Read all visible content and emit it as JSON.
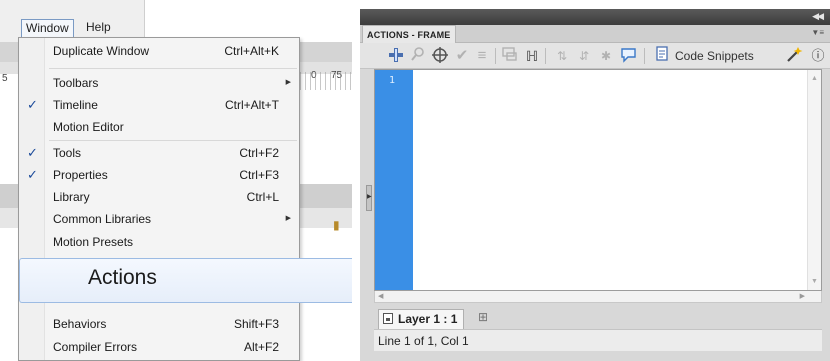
{
  "menubar": {
    "items": [
      "Window",
      "Help"
    ]
  },
  "background": {
    "left_numeral": "5",
    "mid_numeral": "0",
    "right_numeral": "75"
  },
  "window_menu": {
    "items": [
      {
        "label": "Duplicate Window",
        "shortcut": "Ctrl+Alt+K",
        "checked": false,
        "submenu": false
      },
      {
        "label": "Toolbars",
        "shortcut": "",
        "checked": false,
        "submenu": true
      },
      {
        "label": "Timeline",
        "shortcut": "Ctrl+Alt+T",
        "checked": true,
        "submenu": false
      },
      {
        "label": "Motion Editor",
        "shortcut": "",
        "checked": false,
        "submenu": false
      },
      {
        "label": "Tools",
        "shortcut": "Ctrl+F2",
        "checked": true,
        "submenu": false
      },
      {
        "label": "Properties",
        "shortcut": "Ctrl+F3",
        "checked": true,
        "submenu": false
      },
      {
        "label": "Library",
        "shortcut": "Ctrl+L",
        "checked": false,
        "submenu": false
      },
      {
        "label": "Common Libraries",
        "shortcut": "",
        "checked": false,
        "submenu": true
      },
      {
        "label": "Motion Presets",
        "shortcut": "",
        "checked": false,
        "submenu": false
      },
      {
        "label": "Actions",
        "shortcut": "",
        "checked": false,
        "submenu": false,
        "highlighted": true
      },
      {
        "label": "Behaviors",
        "shortcut": "Shift+F3",
        "checked": false,
        "submenu": false
      },
      {
        "label": "Compiler Errors",
        "shortcut": "Alt+F2",
        "checked": false,
        "submenu": false
      }
    ]
  },
  "actions_panel": {
    "tab_title": "ACTIONS - FRAME",
    "toolbar": {
      "code_snippets_label": "Code Snippets",
      "icons": [
        "add-script-icon",
        "find-icon",
        "insert-target-path-icon",
        "check-syntax-icon",
        "auto-format-icon",
        "show-code-hint-icon",
        "debug-options-icon",
        "collapse-between-braces-icon",
        "collapse-selection-icon",
        "expand-all-icon",
        "comment-icon",
        "code-snippets-icon",
        "wizard-wand-icon",
        "help-icon"
      ]
    },
    "editor": {
      "line_numbers": [
        "1"
      ]
    },
    "layer_tab_label": "Layer 1 : 1",
    "status": "Line 1 of 1, Col 1"
  },
  "colors": {
    "gutter_blue": "#3a8fe6",
    "check_blue": "#1b4a9a",
    "highlight_border": "#9cbbe3"
  }
}
